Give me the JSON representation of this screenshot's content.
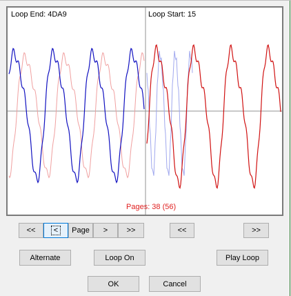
{
  "waveform": {
    "loop_end_label": "Loop End: 4DA9",
    "loop_start_label": "Loop Start: 15",
    "pages_label": "Pages: 38 (56)",
    "colors": {
      "dark_blue": "#1010c0",
      "light_blue": "#a0a8ee",
      "red": "#d01010",
      "light_red": "#f0a0a0",
      "grid": "#909090"
    }
  },
  "nav_left": {
    "first_label": "<<",
    "prev_label": "<",
    "page_label": "Page",
    "next_label": ">",
    "last_label": ">>"
  },
  "nav_right": {
    "prev_label": "<<",
    "next_label": ">>"
  },
  "actions": {
    "alternate_label": "Alternate",
    "loop_on_label": "Loop On",
    "play_loop_label": "Play Loop"
  },
  "dialog": {
    "ok_label": "OK",
    "cancel_label": "Cancel"
  }
}
